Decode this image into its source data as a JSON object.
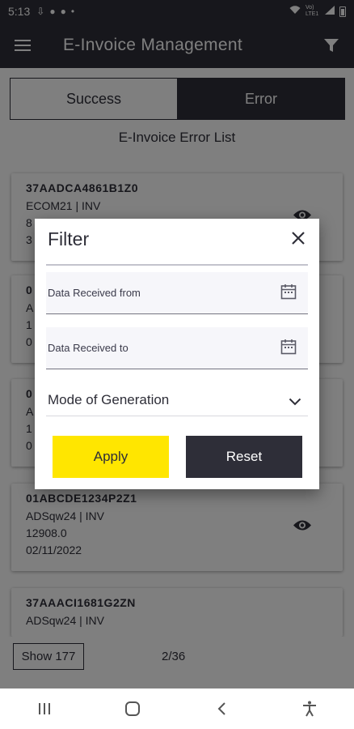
{
  "status_bar": {
    "time": "5:13",
    "network": "Vo) LTE1"
  },
  "app_bar": {
    "title": "E-Invoice Management"
  },
  "tabs": [
    {
      "label": "Success",
      "selected": false
    },
    {
      "label": "Error",
      "selected": true
    }
  ],
  "list_title": "E-Invoice Error List",
  "cards": [
    {
      "gstin": "37AADCA4861B1Z0",
      "mode": "ECOM21 | INV",
      "amount": "8",
      "date": "3"
    },
    {
      "gstin": "0",
      "mode": "A",
      "amount": "1",
      "date": "0"
    },
    {
      "gstin": "0",
      "mode": "A",
      "amount": "1",
      "date": "0"
    },
    {
      "gstin": "01ABCDE1234P2Z1",
      "mode": "ADSqw24 | INV",
      "amount": "12908.0",
      "date": "02/11/2022"
    },
    {
      "gstin": "37AAACI1681G2ZN",
      "mode": "ADSqw24 | INV",
      "amount": "",
      "date": ""
    }
  ],
  "footer": {
    "show_label": "Show 177",
    "pager": "2/36"
  },
  "dialog": {
    "title": "Filter",
    "from_label": "Data Received from",
    "to_label": "Data Received to",
    "mode_label": "Mode of Generation",
    "apply_label": "Apply",
    "reset_label": "Reset"
  },
  "colors": {
    "dark": "#2e2e38",
    "accent_yellow": "#ffe600",
    "field_bg": "#f6f6fa"
  }
}
